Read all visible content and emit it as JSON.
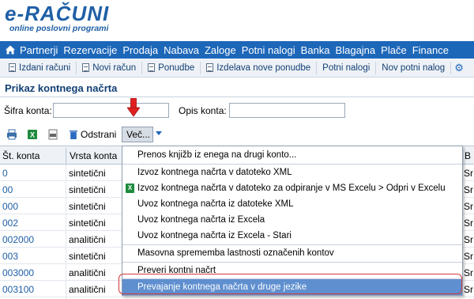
{
  "logo": {
    "title": "e-RAČUNI",
    "subtitle": "online poslovni programi"
  },
  "main_nav": [
    "Partnerji",
    "Rezervacije",
    "Prodaja",
    "Nabava",
    "Zaloge",
    "Potni nalogi",
    "Banka",
    "Blagajna",
    "Plače",
    "Finance"
  ],
  "sub_nav": [
    "Izdani računi",
    "Novi račun",
    "Ponudbe",
    "Izdelava nove ponudbe",
    "Potni nalogi",
    "Nov potni nalog"
  ],
  "page_title": "Prikaz kontnega načrta",
  "filters": {
    "sifra_label": "Šifra konta:",
    "sifra_value": "",
    "opis_label": "Opis konta:",
    "opis_value": ""
  },
  "toolbar": {
    "delete_label": "Odstrani",
    "more_label": "Več..."
  },
  "table": {
    "columns": [
      "Št. konta",
      "Vrsta konta",
      "B"
    ],
    "rows": [
      {
        "id": "0",
        "type": "sintetični",
        "extra": "Sr"
      },
      {
        "id": "00",
        "type": "sintetični",
        "extra": "Sr"
      },
      {
        "id": "000",
        "type": "sintetični",
        "extra": "Sr"
      },
      {
        "id": "002",
        "type": "sintetični",
        "extra": "Sr"
      },
      {
        "id": "002000",
        "type": "analitični",
        "extra": "Sr"
      },
      {
        "id": "003",
        "type": "sintetični",
        "extra": "Sr"
      },
      {
        "id": "003000",
        "type": "analitični",
        "extra": "Sr"
      },
      {
        "id": "003100",
        "type": "analitični",
        "extra": "Sr"
      }
    ]
  },
  "dropdown": {
    "items": [
      "Prenos knjižb iz enega na drugi konto...",
      "Izvoz kontnega načrta v datoteko XML",
      "Izvoz kontnega načrta v datoteko za odpiranje v MS Excelu > Odpri v Excelu",
      "Uvoz kontnega načrta iz datoteke XML",
      "Uvoz kontnega načrta iz Excela",
      "Uvoz kontnega načrta iz Excela - Stari",
      "Masovna sprememba lastnosti označenih kontov",
      "Preveri kontni načrt",
      "Prevajanje kontnega načrta v druge jezike"
    ]
  },
  "colors": {
    "brand": "#1d67b9",
    "highlight": "#5f8fcf",
    "annotation": "#d23a3a"
  }
}
